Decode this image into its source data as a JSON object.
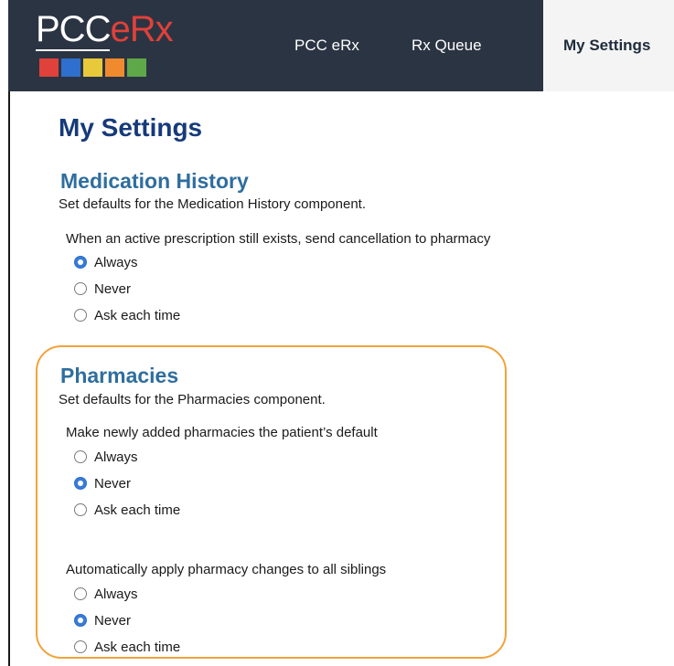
{
  "logo": {
    "text_pcc": "PCC",
    "text_erx": "eRx",
    "squares": [
      "#e0413a",
      "#2f6fce",
      "#e8c93a",
      "#f08a2e",
      "#5fa84a"
    ]
  },
  "nav": {
    "items": [
      {
        "label": "PCC eRx"
      },
      {
        "label": "Rx Queue"
      },
      {
        "label": "My Settings",
        "active": true
      }
    ]
  },
  "page": {
    "title": "My Settings"
  },
  "sections": {
    "medication_history": {
      "title": "Medication History",
      "description": "Set defaults for the Medication History component.",
      "question": "When an active prescription still exists, send cancellation to pharmacy",
      "options": [
        "Always",
        "Never",
        "Ask each time"
      ],
      "selected": "Always"
    },
    "pharmacies": {
      "title": "Pharmacies",
      "description": "Set defaults for the Pharmacies component.",
      "default_question": "Make newly added pharmacies the patient’s default",
      "default_options": [
        "Always",
        "Never",
        "Ask each time"
      ],
      "default_selected": "Never",
      "siblings_question": "Automatically apply pharmacy changes to all siblings",
      "siblings_options": [
        "Always",
        "Never",
        "Ask each time"
      ],
      "siblings_selected": "Never"
    }
  },
  "colors": {
    "topbar": "#2b3442",
    "title": "#163a7a",
    "section_title": "#2f6e9e",
    "highlight": "#f2a23a",
    "radio_checked": "#3a7bd5"
  }
}
